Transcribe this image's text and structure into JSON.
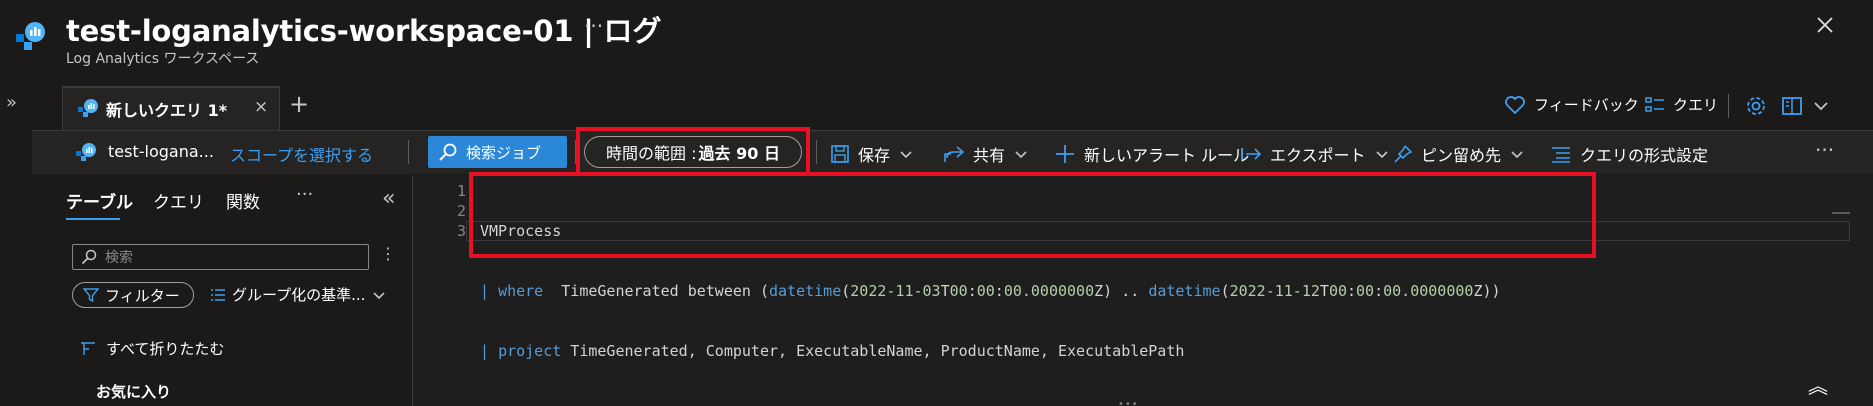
{
  "header": {
    "title": "test-loganalytics-workspace-01 | ログ",
    "subtitle": "Log Analytics ワークスペース",
    "more": "···",
    "close": "✕"
  },
  "rail": {
    "expand": "»"
  },
  "tabs": {
    "query_tab_label": "新しいクエリ 1*",
    "close": "×",
    "add": "+"
  },
  "top_right": {
    "feedback": "フィードバック",
    "queries": "クエリ"
  },
  "toolbar": {
    "scope_name": "test-logana...",
    "scope_select": "スコープを選択する",
    "search_job": "検索ジョブ",
    "time_range_label": "時間の範囲 : ",
    "time_range_value": "過去 90 日",
    "save": "保存",
    "share": "共有",
    "new_alert": "新しいアラート ルール",
    "export": "エクスポート",
    "pin": "ピン留め先",
    "format": "クエリの形式設定",
    "more": "···"
  },
  "left_pane": {
    "tabs": [
      "テーブル",
      "クエリ",
      "関数"
    ],
    "tabs_more": "···",
    "collapse": "«",
    "search_placeholder": "検索",
    "search_more": "⋮",
    "filter": "フィルター",
    "group_by": "グループ化の基準...",
    "collapse_all": "すべて折りたたむ",
    "favorites": "お気に入り"
  },
  "editor": {
    "line_numbers": [
      "1",
      "2",
      "3"
    ],
    "lines": [
      "VMProcess",
      "| where  TimeGenerated between (datetime(2022-11-03T00:00:00.0000000Z) .. datetime(2022-11-12T00:00:00.0000000Z))",
      "| project TimeGenerated, Computer, ExecutableName, ProductName, ExecutablePath"
    ],
    "expand": "︽"
  },
  "colors": {
    "accent": "#3aa0f3",
    "highlight_box": "#e81123",
    "primary_button": "#2b88d8"
  }
}
